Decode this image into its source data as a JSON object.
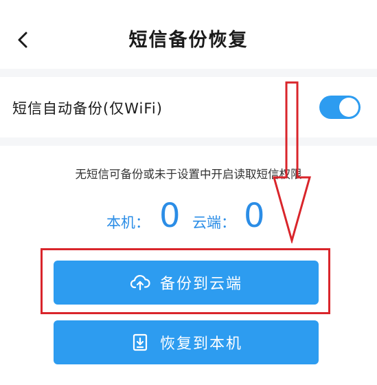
{
  "header": {
    "title": "短信备份恢复",
    "back_icon": "chevron-left-icon"
  },
  "settings": {
    "auto_backup_label": "短信自动备份(仅WiFi)",
    "auto_backup_enabled": true
  },
  "status": {
    "notice": "无短信可备份或未于设置中开启读取短信权限",
    "local_label": "本机：",
    "local_count": "0",
    "cloud_label": "云端：",
    "cloud_count": "0"
  },
  "actions": {
    "backup_label": "备份到云端",
    "backup_icon": "cloud-upload-icon",
    "restore_label": "恢复到本机",
    "restore_icon": "download-file-icon"
  },
  "colors": {
    "accent": "#2d9cf0",
    "count_text": "#2b8de6",
    "annotation": "#d9252b"
  }
}
